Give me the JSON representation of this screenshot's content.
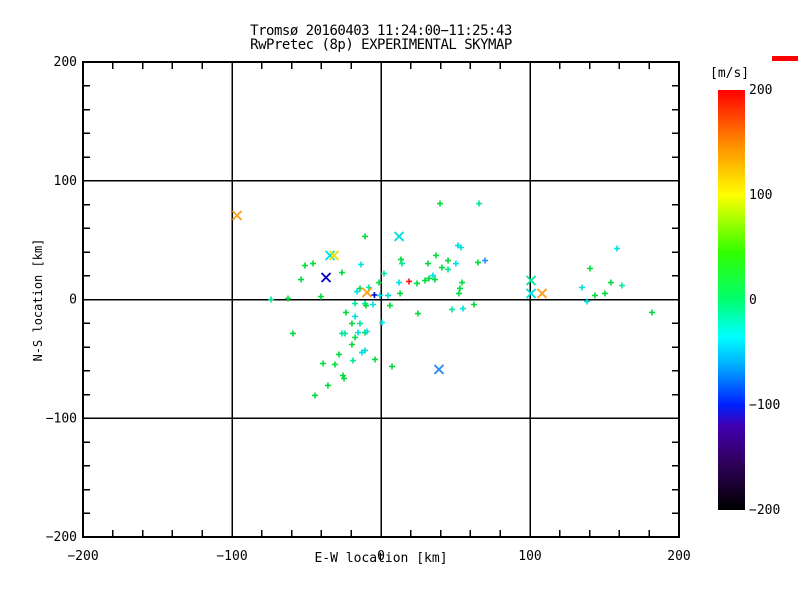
{
  "chart_data": {
    "type": "scatter",
    "title_line1": "Tromsø 20160403 11:24:00−11:25:43",
    "title_line2": "RwPretec (8p) EXPERIMENTAL SKYMAP",
    "xlabel": "E-W location [km]",
    "ylabel": "N-S location [km]",
    "xlim": [
      -200,
      200
    ],
    "ylim": [
      -200,
      200
    ],
    "x_major_ticks": [
      -200,
      -100,
      0,
      100,
      200
    ],
    "y_major_ticks": [
      -200,
      -100,
      0,
      100,
      200
    ],
    "x_tick_labels": [
      "−200",
      "−100",
      "0",
      "100",
      "200"
    ],
    "y_tick_labels": [
      "−200",
      "−100",
      "0",
      "100",
      "200"
    ],
    "minor_tick_step": 20,
    "grid_values": [
      -100,
      0,
      100
    ],
    "grid_on": true,
    "marker_colors": {
      "g": "#00DC3C",
      "t": "#00E89C",
      "c": "#00E0E0",
      "y": "#E8E400",
      "o": "#FFA01E",
      "navy": "#0000C8",
      "b": "#2C8CFF",
      "r": "#FF1010"
    },
    "points_plus": [
      [
        -51.0,
        28.6,
        "g"
      ],
      [
        -45.6,
        30.3,
        "g"
      ],
      [
        -53.7,
        16.8,
        "g"
      ],
      [
        -26.2,
        22.7,
        "g"
      ],
      [
        -13.4,
        29.5,
        "c"
      ],
      [
        -10.7,
        53.1,
        "g"
      ],
      [
        13.4,
        33.7,
        "g"
      ],
      [
        2.0,
        21.9,
        "t"
      ],
      [
        -1.3,
        14.3,
        "g"
      ],
      [
        12.1,
        14.3,
        "c"
      ],
      [
        18.8,
        15.2,
        "r"
      ],
      [
        24.2,
        13.5,
        "g"
      ],
      [
        29.5,
        16.0,
        "g"
      ],
      [
        14.1,
        30.3,
        "t"
      ],
      [
        -16.1,
        6.7,
        "c"
      ],
      [
        -14.1,
        9.3,
        "g"
      ],
      [
        -62.4,
        0.8,
        "g"
      ],
      [
        -73.8,
        0.0,
        "t"
      ],
      [
        -40.3,
        2.5,
        "g"
      ],
      [
        -59.1,
        -28.6,
        "g"
      ],
      [
        -4.4,
        3.8,
        "navy"
      ],
      [
        -0.7,
        3.4,
        "c"
      ],
      [
        4.7,
        3.4,
        "c"
      ],
      [
        12.8,
        5.1,
        "g"
      ],
      [
        -17.4,
        -3.4,
        "t"
      ],
      [
        -10.7,
        -3.4,
        "t"
      ],
      [
        -10.1,
        -5.1,
        "g"
      ],
      [
        -5.4,
        -4.2,
        "c"
      ],
      [
        6.0,
        -5.1,
        "g"
      ],
      [
        24.8,
        -11.8,
        "g"
      ],
      [
        0.7,
        -19.4,
        "c"
      ],
      [
        -19.5,
        -20.2,
        "g"
      ],
      [
        -14.1,
        -20.2,
        "t"
      ],
      [
        -23.5,
        -10.9,
        "g"
      ],
      [
        -17.4,
        -14.3,
        "c"
      ],
      [
        -8.1,
        10.1,
        "t"
      ],
      [
        -24.2,
        -28.6,
        "t"
      ],
      [
        -17.4,
        -32.0,
        "g"
      ],
      [
        -10.7,
        -27.8,
        "g"
      ],
      [
        -10.7,
        -42.9,
        "c"
      ],
      [
        -4.0,
        -50.5,
        "g"
      ],
      [
        -18.8,
        -51.4,
        "t"
      ],
      [
        -26.2,
        -28.6,
        "t"
      ],
      [
        -15.4,
        -27.8,
        "c"
      ],
      [
        -9.4,
        -26.9,
        "c"
      ],
      [
        -19.5,
        -37.9,
        "g"
      ],
      [
        -12.8,
        -44.6,
        "c"
      ],
      [
        -28.2,
        -46.3,
        "g"
      ],
      [
        -38.9,
        -53.9,
        "g"
      ],
      [
        -30.9,
        -54.7,
        "g"
      ],
      [
        -25.5,
        -64.0,
        "g"
      ],
      [
        -24.8,
        -66.5,
        "g"
      ],
      [
        -35.6,
        -72.4,
        "g"
      ],
      [
        -44.3,
        -80.8,
        "g"
      ],
      [
        7.4,
        -56.4,
        "g"
      ],
      [
        51.7,
        45.5,
        "c"
      ],
      [
        53.7,
        43.8,
        "c"
      ],
      [
        36.9,
        37.1,
        "g"
      ],
      [
        45.0,
        32.8,
        "g"
      ],
      [
        50.3,
        30.3,
        "c"
      ],
      [
        65.1,
        31.2,
        "g"
      ],
      [
        69.8,
        32.8,
        "b"
      ],
      [
        31.5,
        30.3,
        "g"
      ],
      [
        40.9,
        26.9,
        "g"
      ],
      [
        45.0,
        25.3,
        "t"
      ],
      [
        34.9,
        20.2,
        "c"
      ],
      [
        32.2,
        17.7,
        "g"
      ],
      [
        36.2,
        16.8,
        "g"
      ],
      [
        54.4,
        14.3,
        "g"
      ],
      [
        53.0,
        9.3,
        "g"
      ],
      [
        52.3,
        5.1,
        "g"
      ],
      [
        62.4,
        -4.2,
        "g"
      ],
      [
        47.6,
        -8.4,
        "t"
      ],
      [
        55.0,
        -7.6,
        "c"
      ],
      [
        39.6,
        80.8,
        "g"
      ],
      [
        65.8,
        80.8,
        "t"
      ],
      [
        158.4,
        42.9,
        "c"
      ],
      [
        140.3,
        26.1,
        "g"
      ],
      [
        154.3,
        14.3,
        "g"
      ],
      [
        161.7,
        11.8,
        "t"
      ],
      [
        134.9,
        10.1,
        "c"
      ],
      [
        143.6,
        3.4,
        "g"
      ],
      [
        150.3,
        5.1,
        "g"
      ],
      [
        138.3,
        -1.7,
        "c"
      ],
      [
        181.9,
        -10.9,
        "g"
      ]
    ],
    "points_cross": [
      [
        -96.6,
        70.7,
        "o"
      ],
      [
        12.1,
        53.1,
        "c"
      ],
      [
        -34.2,
        37.1,
        "c"
      ],
      [
        -31.5,
        37.1,
        "y"
      ],
      [
        -36.9,
        18.5,
        "navy"
      ],
      [
        -9.4,
        5.9,
        "o"
      ],
      [
        38.9,
        -58.9,
        "b"
      ],
      [
        100.7,
        16.0,
        "t"
      ],
      [
        100.7,
        5.1,
        "c"
      ],
      [
        108.1,
        5.1,
        "o"
      ]
    ],
    "colorbar": {
      "label": "[m/s]",
      "tick_values": [
        200,
        100,
        0,
        -100,
        -200
      ],
      "tick_labels": [
        "200",
        "100",
        "0",
        "−100",
        "−200"
      ],
      "range": [
        -200,
        200
      ],
      "gradient_stops": [
        [
          -200,
          "#000000"
        ],
        [
          -155,
          "#30005C"
        ],
        [
          -120,
          "#4000B0"
        ],
        [
          -100,
          "#0020FF"
        ],
        [
          -60,
          "#00B4FF"
        ],
        [
          -35,
          "#00FFFF"
        ],
        [
          0,
          "#00FF70"
        ],
        [
          45,
          "#30FF00"
        ],
        [
          100,
          "#FFFF00"
        ],
        [
          150,
          "#FF8800"
        ],
        [
          200,
          "#FF0000"
        ]
      ]
    },
    "top_right_marker_color": "#FF0000"
  }
}
